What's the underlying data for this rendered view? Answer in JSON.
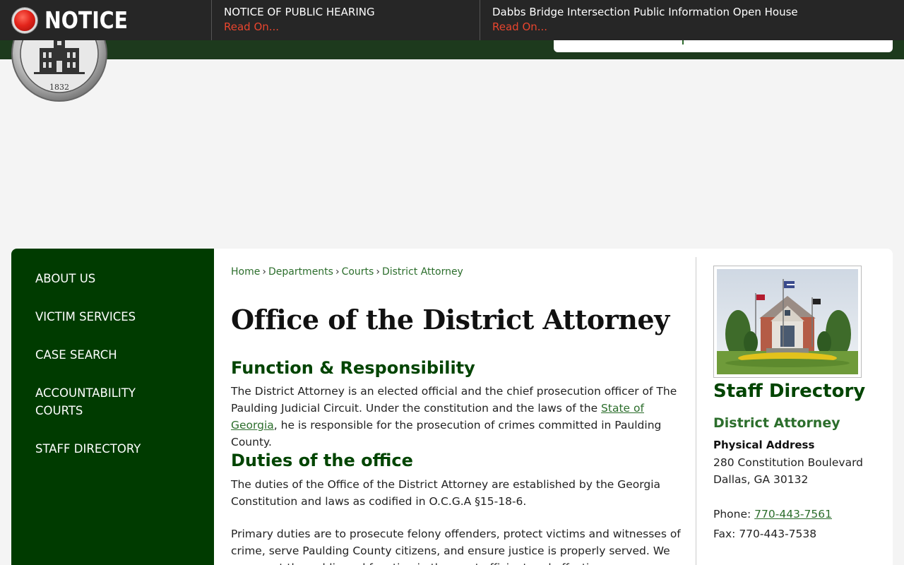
{
  "notice": {
    "label": "NOTICE",
    "items": [
      {
        "title": "NOTICE OF PUBLIC HEARING",
        "link": "Read On..."
      },
      {
        "title": "Dabbs Bridge Intersection Public Information Open House",
        "link": "Read On..."
      }
    ]
  },
  "seal": {
    "year": "1832"
  },
  "sidenav": {
    "items": [
      {
        "label": "ABOUT US"
      },
      {
        "label": "VICTIM SERVICES"
      },
      {
        "label": "CASE SEARCH"
      },
      {
        "label": "ACCOUNTABILITY COURTS"
      },
      {
        "label": "STAFF DIRECTORY"
      }
    ]
  },
  "breadcrumb": [
    "Home",
    "Departments",
    "Courts",
    "District Attorney"
  ],
  "breadcrumb_sep": "›",
  "main": {
    "title": "Office of the District Attorney",
    "section1": {
      "heading": "Function & Responsibility",
      "text_before": "The District Attorney is an elected official and the chief prosecution officer of The Paulding Judicial Circuit. Under the constitution and the laws of the ",
      "link": "State of Georgia",
      "text_after": ", he is responsible for the prosecution of crimes committed in Paulding County."
    },
    "section2": {
      "heading": "Duties of the office",
      "para1": "The duties of the Office of the District Attorney are established by the Georgia Constitution and laws as codified in O.C.G.A §15-18-6.",
      "para2": "Primary duties are to prosecute felony offenders, protect victims and witnesses of crime, serve Paulding County citizens, and ensure justice is properly served. We represent the public and function in the most efficient and effective"
    }
  },
  "aside": {
    "heading": "Staff Directory",
    "dept": "District Attorney",
    "address_label": "Physical Address",
    "address_line1": "280 Constitution Boulevard",
    "address_line2": "Dallas, GA 30132",
    "phone_label": "Phone: ",
    "phone": "770-443-7561",
    "fax": "Fax: 770-443-7538"
  },
  "colors": {
    "brand_green": "#003b00",
    "link_green": "#2c6e2c",
    "notice_red": "#e8452e"
  }
}
